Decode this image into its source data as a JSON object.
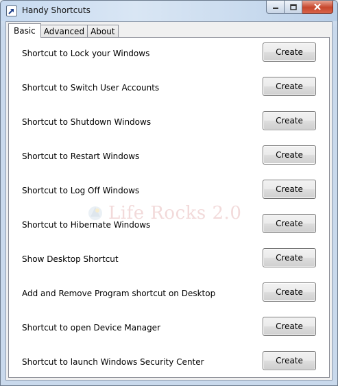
{
  "window": {
    "title": "Handy Shortcuts",
    "icon": "shortcut-arrow-icon",
    "controls": [
      "minimize-icon",
      "maximize-icon",
      "close-icon"
    ]
  },
  "tabs": [
    {
      "label": "Basic",
      "active": true
    },
    {
      "label": "Advanced",
      "active": false
    },
    {
      "label": "About",
      "active": false
    }
  ],
  "shortcuts": [
    {
      "label": "Shortcut to Lock your Windows",
      "button": "Create"
    },
    {
      "label": "Shortcut to Switch User Accounts",
      "button": "Create"
    },
    {
      "label": "Shortcut to Shutdown Windows",
      "button": "Create"
    },
    {
      "label": "Shortcut to Restart Windows",
      "button": "Create"
    },
    {
      "label": "Shortcut to Log Off Windows",
      "button": "Create"
    },
    {
      "label": "Shortcut to Hibernate Windows",
      "button": "Create"
    },
    {
      "label": "Show Desktop Shortcut",
      "button": "Create"
    },
    {
      "label": "Add and Remove Program shortcut on Desktop",
      "button": "Create"
    },
    {
      "label": "Shortcut to open Device Manager",
      "button": "Create"
    },
    {
      "label": "Shortcut to launch Windows Security Center",
      "button": "Create"
    }
  ],
  "watermark": {
    "text": "Life Rocks 2.0",
    "icon": "life-rocks-logo-icon"
  }
}
